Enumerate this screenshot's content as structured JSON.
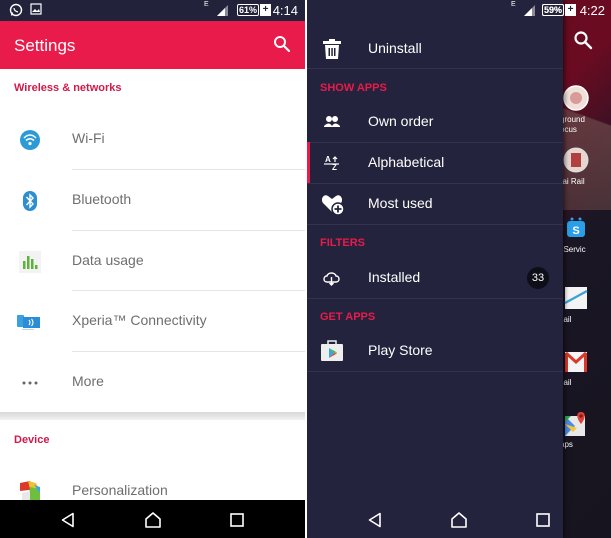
{
  "left_screen": {
    "status_bar": {
      "network_type": "E",
      "battery_percent": "61%",
      "battery_charging": "+",
      "time": "4:14",
      "notification_icons": [
        "whatsapp-icon",
        "image-icon"
      ]
    },
    "app_bar": {
      "title": "Settings",
      "search_icon": "search-icon"
    },
    "sections": [
      {
        "title": "Wireless & networks",
        "items": [
          {
            "label": "Wi-Fi",
            "icon": "wifi-icon"
          },
          {
            "label": "Bluetooth",
            "icon": "bluetooth-icon"
          },
          {
            "label": "Data usage",
            "icon": "data-usage-icon"
          },
          {
            "label": "Xperia™ Connectivity",
            "icon": "xperia-connectivity-icon"
          },
          {
            "label": "More",
            "icon": "more-dots-icon"
          }
        ]
      },
      {
        "title": "Device",
        "items": [
          {
            "label": "Personalization",
            "icon": "personalization-icon"
          }
        ]
      }
    ],
    "nav_bar": [
      "back",
      "home",
      "recents"
    ]
  },
  "right_screen": {
    "status_bar": {
      "network_type": "E",
      "battery_percent": "59%",
      "battery_charging": "+",
      "time": "4:22"
    },
    "drawer": {
      "top_item": {
        "label": "Uninstall",
        "icon": "trash-icon"
      },
      "sections": [
        {
          "title": "SHOW APPS",
          "items": [
            {
              "label": "Own order",
              "icon": "own-order-icon",
              "active": false
            },
            {
              "label": "Alphabetical",
              "icon": "alphabetical-sort-icon",
              "active": true
            },
            {
              "label": "Most used",
              "icon": "heart-plus-icon",
              "active": false
            }
          ]
        },
        {
          "title": "FILTERS",
          "items": [
            {
              "label": "Installed",
              "icon": "cloud-download-icon",
              "badge": "33"
            }
          ]
        },
        {
          "title": "GET APPS",
          "items": [
            {
              "label": "Play Store",
              "icon": "play-store-icon"
            }
          ]
        }
      ]
    },
    "home_apps_partial": [
      {
        "label_line1": "ground",
        "label_line2": "ocus"
      },
      {
        "label_line1": "nai Rail",
        "label_line2": ""
      },
      {
        "label_line1": "eServic",
        "label_line2": "e"
      },
      {
        "label_line1": "nail",
        "label_line2": ""
      },
      {
        "label_line1": "nail",
        "label_line2": ""
      },
      {
        "label_line1": "aps",
        "label_line2": ""
      }
    ],
    "nav_bar": [
      "back",
      "home",
      "recents"
    ]
  },
  "colors": {
    "accent": "#e91b4a",
    "drawer_bg": "#23233d",
    "status_bar_bg": "#22223a"
  }
}
